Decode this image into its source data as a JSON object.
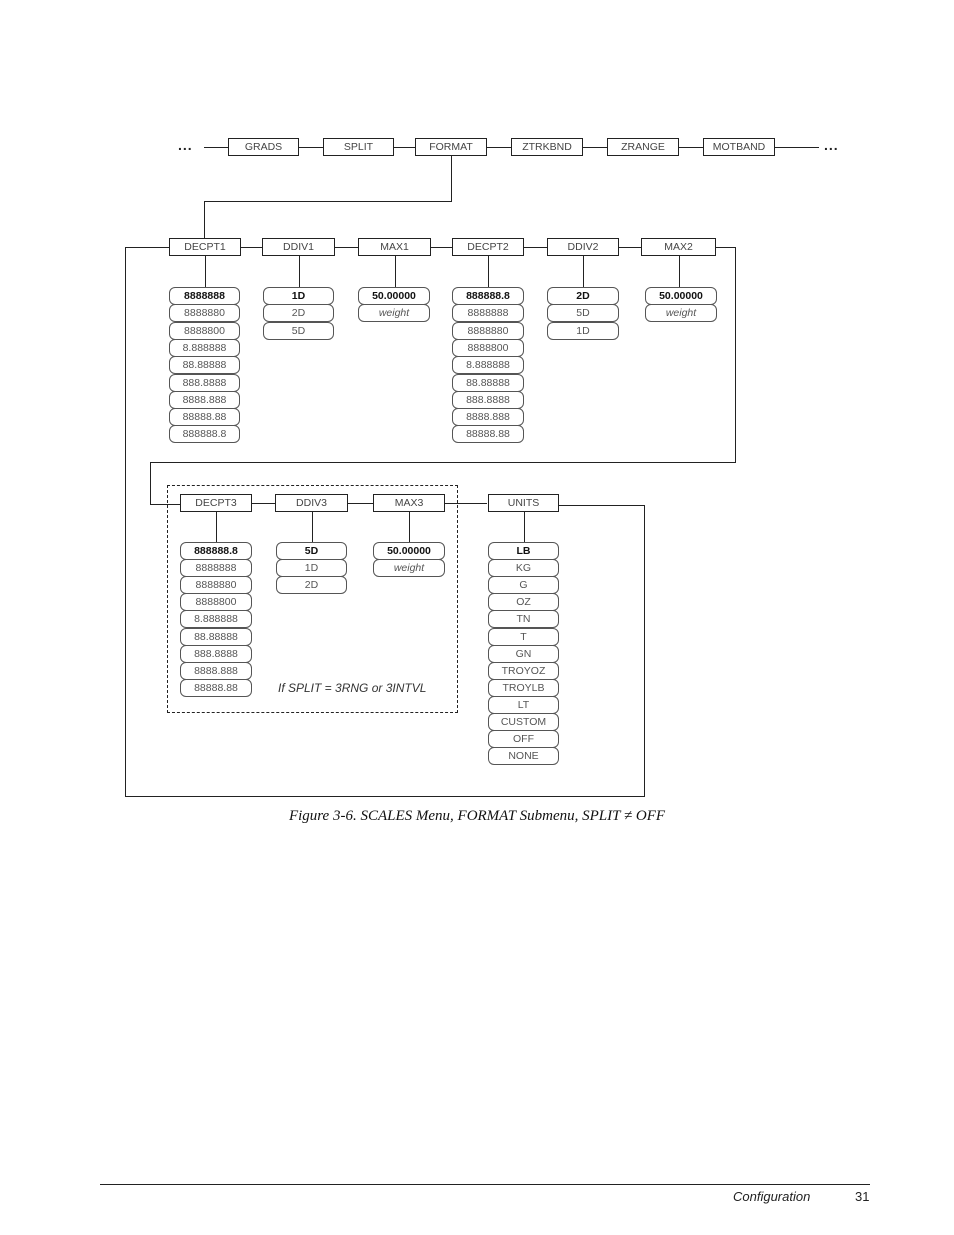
{
  "top_menu": {
    "leading_ellipsis": "...",
    "trailing_ellipsis": "...",
    "items": [
      "GRADS",
      "SPLIT",
      "FORMAT",
      "ZTRKBND",
      "ZRANGE",
      "MOTBAND"
    ]
  },
  "row1": [
    {
      "label": "DECPT1",
      "options": [
        "8888888",
        "8888880",
        "8888800",
        "8.888888",
        "88.88888",
        "888.8888",
        "8888.888",
        "88888.88",
        "888888.8"
      ],
      "default_index": 0
    },
    {
      "label": "DDIV1",
      "options": [
        "1D",
        "2D",
        "5D"
      ],
      "default_index": 0
    },
    {
      "label": "MAX1",
      "options": [
        "50.00000",
        "weight"
      ],
      "default_index": 0
    },
    {
      "label": "DECPT2",
      "options": [
        "888888.8",
        "8888888",
        "8888880",
        "8888800",
        "8.888888",
        "88.88888",
        "888.8888",
        "8888.888",
        "88888.88"
      ],
      "default_index": 0
    },
    {
      "label": "DDIV2",
      "options": [
        "2D",
        "5D",
        "1D"
      ],
      "default_index": 0
    },
    {
      "label": "MAX2",
      "options": [
        "50.00000",
        "weight"
      ],
      "default_index": 0
    }
  ],
  "row2": [
    {
      "label": "DECPT3",
      "options": [
        "888888.8",
        "8888888",
        "8888880",
        "8888800",
        "8.888888",
        "88.88888",
        "888.8888",
        "8888.888",
        "88888.88"
      ],
      "default_index": 0
    },
    {
      "label": "DDIV3",
      "options": [
        "5D",
        "1D",
        "2D"
      ],
      "default_index": 0
    },
    {
      "label": "MAX3",
      "options": [
        "50.00000",
        "weight"
      ],
      "default_index": 0
    },
    {
      "label": "UNITS",
      "options": [
        "LB",
        "KG",
        "G",
        "OZ",
        "TN",
        "T",
        "GN",
        "TROYOZ",
        "TROYLB",
        "LT",
        "CUSTOM",
        "OFF",
        "NONE"
      ],
      "default_index": 0
    }
  ],
  "conditional_note": "If SPLIT = 3RNG or 3INTVL",
  "caption": "Figure 3-6. SCALES Menu, FORMAT Submenu, SPLIT ≠ OFF",
  "footer": {
    "section": "Configuration",
    "page_number": "31"
  }
}
